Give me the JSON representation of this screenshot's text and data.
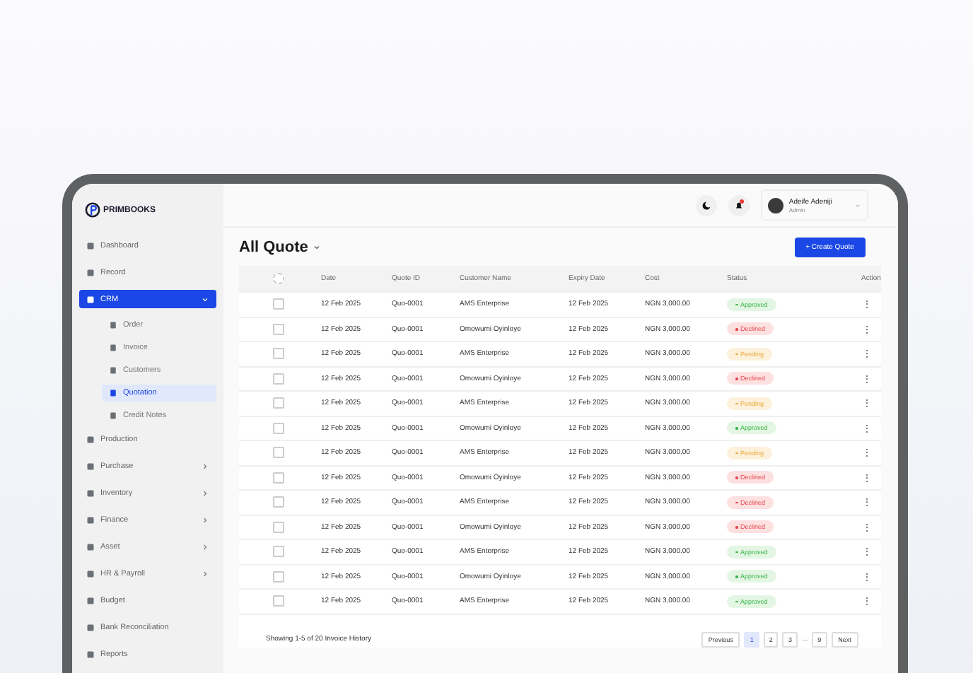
{
  "brand": {
    "name": "PRIMBOOKS"
  },
  "sidebar": {
    "items": [
      {
        "label": "Dashboard",
        "kind": "link",
        "selected": false
      },
      {
        "label": "Record",
        "kind": "link",
        "selected": false
      },
      {
        "label": "CRM",
        "kind": "group",
        "expanded": true,
        "selected": true,
        "children": [
          {
            "label": "Order",
            "selected": false
          },
          {
            "label": "Invoice",
            "selected": false
          },
          {
            "label": "Customers",
            "selected": false
          },
          {
            "label": "Quotation",
            "selected": true
          },
          {
            "label": "Credit Notes",
            "selected": false
          }
        ]
      },
      {
        "label": "Production",
        "kind": "link",
        "selected": false
      },
      {
        "label": "Purchase",
        "kind": "group",
        "expanded": false,
        "selected": false
      },
      {
        "label": "Inventory",
        "kind": "group",
        "expanded": false,
        "selected": false
      },
      {
        "label": "Finance",
        "kind": "group",
        "expanded": false,
        "selected": false
      },
      {
        "label": "Asset",
        "kind": "group",
        "expanded": false,
        "selected": false
      },
      {
        "label": "HR & Payroll",
        "kind": "group",
        "expanded": false,
        "selected": false
      },
      {
        "label": "Budget",
        "kind": "link",
        "selected": false
      },
      {
        "label": "Bank Reconciliation",
        "kind": "link",
        "selected": false
      },
      {
        "label": "Reports",
        "kind": "link",
        "selected": false
      }
    ]
  },
  "header": {
    "notification_unread": true,
    "user": {
      "name": "Adeife Adeniji",
      "role": "Admin"
    }
  },
  "page": {
    "title": "All Quote",
    "create_button": "+ Create Quote"
  },
  "table": {
    "select_all_checked": false,
    "columns": [
      "Date",
      "Quote ID",
      "Customer Name",
      "Expiry Date",
      "Cost",
      "Status",
      "Action"
    ],
    "rows": [
      {
        "checked": false,
        "date": "12 Feb 2025",
        "quote_id": "Quo-0001",
        "customer": "AMS Enterprise",
        "expiry": "12 Feb 2025",
        "cost": "NGN 3,000.00",
        "status": {
          "kind": "approved",
          "label": "Approved"
        },
        "action": "⋮"
      },
      {
        "checked": false,
        "date": "12 Feb 2025",
        "quote_id": "Quo-0001",
        "customer": "Omowumi Oyinloye",
        "expiry": "12 Feb 2025",
        "cost": "NGN 3,000.00",
        "status": {
          "kind": "declined",
          "label": "Declined"
        },
        "action": "⋮"
      },
      {
        "checked": false,
        "date": "12 Feb 2025",
        "quote_id": "Quo-0001",
        "customer": "AMS Enterprise",
        "expiry": "12 Feb 2025",
        "cost": "NGN 3,000.00",
        "status": {
          "kind": "pending",
          "label": "Pending"
        },
        "action": "⋮"
      },
      {
        "checked": false,
        "date": "12 Feb 2025",
        "quote_id": "Quo-0001",
        "customer": "Omowumi Oyinloye",
        "expiry": "12 Feb 2025",
        "cost": "NGN 3,000.00",
        "status": {
          "kind": "declined",
          "label": "Declined"
        },
        "action": "⋮"
      },
      {
        "checked": false,
        "date": "12 Feb 2025",
        "quote_id": "Quo-0001",
        "customer": "AMS Enterprise",
        "expiry": "12 Feb 2025",
        "cost": "NGN 3,000.00",
        "status": {
          "kind": "pending",
          "label": "Pending"
        },
        "action": "⋮"
      },
      {
        "checked": false,
        "date": "12 Feb 2025",
        "quote_id": "Quo-0001",
        "customer": "Omowumi Oyinloye",
        "expiry": "12 Feb 2025",
        "cost": "NGN 3,000.00",
        "status": {
          "kind": "approved",
          "label": "Approved"
        },
        "action": "⋮"
      },
      {
        "checked": false,
        "date": "12 Feb 2025",
        "quote_id": "Quo-0001",
        "customer": "AMS Enterprise",
        "expiry": "12 Feb 2025",
        "cost": "NGN 3,000.00",
        "status": {
          "kind": "pending",
          "label": "Pending"
        },
        "action": "⋮"
      },
      {
        "checked": false,
        "date": "12 Feb 2025",
        "quote_id": "Quo-0001",
        "customer": "Omowumi Oyinloye",
        "expiry": "12 Feb 2025",
        "cost": "NGN 3,000.00",
        "status": {
          "kind": "declined",
          "label": "Declined"
        },
        "action": "⋮"
      },
      {
        "checked": false,
        "date": "12 Feb 2025",
        "quote_id": "Quo-0001",
        "customer": "AMS Enterprise",
        "expiry": "12 Feb 2025",
        "cost": "NGN 3,000.00",
        "status": {
          "kind": "declined",
          "label": "Declined"
        },
        "action": "⋮"
      },
      {
        "checked": false,
        "date": "12 Feb 2025",
        "quote_id": "Quo-0001",
        "customer": "Omowumi Oyinloye",
        "expiry": "12 Feb 2025",
        "cost": "NGN 3,000.00",
        "status": {
          "kind": "declined",
          "label": "Declined"
        },
        "action": "⋮"
      },
      {
        "checked": false,
        "date": "12 Feb 2025",
        "quote_id": "Quo-0001",
        "customer": "AMS Enterprise",
        "expiry": "12 Feb 2025",
        "cost": "NGN 3,000.00",
        "status": {
          "kind": "approved",
          "label": "Approved"
        },
        "action": "⋮"
      },
      {
        "checked": false,
        "date": "12 Feb 2025",
        "quote_id": "Quo-0001",
        "customer": "Omowumi Oyinloye",
        "expiry": "12 Feb 2025",
        "cost": "NGN 3,000.00",
        "status": {
          "kind": "approved",
          "label": "Approved"
        },
        "action": "⋮"
      },
      {
        "checked": false,
        "date": "12 Feb 2025",
        "quote_id": "Quo-0001",
        "customer": "AMS Enterprise",
        "expiry": "12 Feb 2025",
        "cost": "NGN 3,000.00",
        "status": {
          "kind": "approved",
          "label": "Approved"
        },
        "action": "⋮"
      }
    ]
  },
  "footer": {
    "summary": "Showing 1-5 of 20 Invoice History",
    "previous": "Previous",
    "pages": [
      {
        "label": "1",
        "kind": "page",
        "selected": true
      },
      {
        "label": "2",
        "kind": "page",
        "selected": false
      },
      {
        "label": "3",
        "kind": "page",
        "selected": false
      },
      {
        "label": "...",
        "kind": "gap",
        "selected": false
      },
      {
        "label": "9",
        "kind": "page",
        "selected": false
      }
    ],
    "next": "Next"
  }
}
